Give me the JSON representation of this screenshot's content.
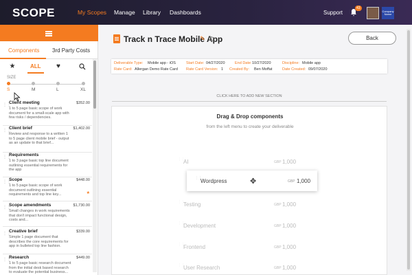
{
  "app": {
    "logo": "SCOPE"
  },
  "nav": {
    "items": [
      "My Scopes",
      "Manage",
      "Library",
      "Dashboards"
    ],
    "support": "Support",
    "notifications": "43",
    "org_label": "Company Name"
  },
  "sidebar": {
    "tabs": [
      "Components",
      "3rd Party Costs"
    ],
    "filter_all": "ALL",
    "size_label": "SIZE",
    "sizes": [
      "S",
      "M",
      "L",
      "XL"
    ],
    "components": [
      {
        "title": "Client meeting",
        "price": "$352.00",
        "desc": "1 to 5 page basic scope of work document for a small-scale app with few risks / dependencies."
      },
      {
        "title": "Client brief",
        "price": "$1,402.00",
        "desc": "Review and response to a written 1 to 5 page client mobile brief - output as an update to that brief..."
      },
      {
        "title": "Requirements",
        "price": "$352.00",
        "desc": "1 to 3 page basic top line document outlining essential requirements for the app"
      },
      {
        "title": "Scope",
        "price": "$448.00",
        "desc": "1 to 5 page basic scope of work document outlining essential requirements and top line key..."
      },
      {
        "title": "Scope amendments",
        "price": "$1,730.00",
        "desc": "Small changes in work requirements that don't impact functional design, costs and..."
      },
      {
        "title": "Creative brief",
        "price": "$339.00",
        "desc": "Simple 1 page document that describes the core requirements for app in bulleted top line fashion."
      },
      {
        "title": "Research",
        "price": "$449.00",
        "desc": "1 to 5 page basic research document from the initial desk based research to evaluate the potential business..."
      }
    ]
  },
  "main": {
    "title": "Track n Trace Mobile App",
    "back": "Back",
    "meta": {
      "deliverable_type_k": "Deliverable Type:",
      "deliverable_type_v": "Mobile app - iOS",
      "start_k": "Start Date:",
      "start_v": "04/27/2020",
      "end_k": "End Date:",
      "end_v": "10/27/2020",
      "discipline_k": "Discipline:",
      "discipline_v": "Mobile app",
      "rate_card_k": "Rate Card:",
      "rate_card_v": "Allergan Demo Rate Card",
      "rate_ver_k": "Rate Card Version:",
      "rate_ver_v": "1",
      "created_by_k": "Created By:",
      "created_by_v": "Ben Moffat",
      "created_k": "Date Created:",
      "created_v": "09/07/2020"
    },
    "add_section": "CLICK HERE TO ADD NEW SECTION",
    "dropzone_title": "Drag & Drop components",
    "dropzone_sub": "from the left menu to create your deliverable",
    "ghost_items": [
      {
        "name": "AI",
        "currency": "GBP",
        "value": "1,000"
      },
      {
        "name": "Testing",
        "currency": "GBP",
        "value": "1,000"
      },
      {
        "name": "Development",
        "currency": "GBP",
        "value": "1,000"
      },
      {
        "name": "Frontend",
        "currency": "GBP",
        "value": "1,000"
      },
      {
        "name": "User Research",
        "currency": "GBP",
        "value": "1,000"
      }
    ],
    "dragging": {
      "name": "Wordpress",
      "currency": "GBP",
      "value": "1,000"
    }
  }
}
